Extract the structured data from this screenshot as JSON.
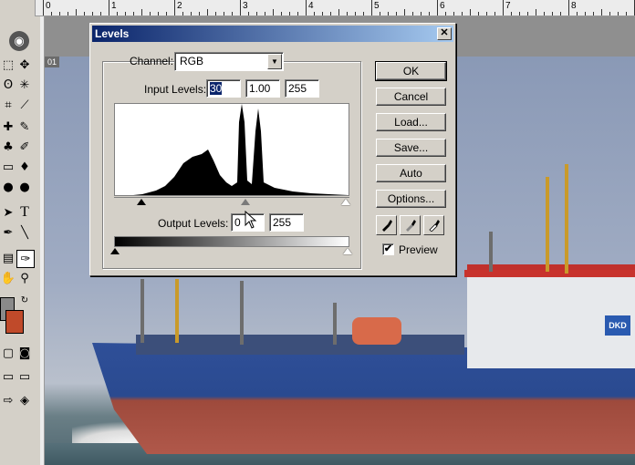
{
  "ruler": {
    "labels": [
      "0",
      "1",
      "2",
      "3",
      "4",
      "5",
      "6",
      "7",
      "8"
    ]
  },
  "document": {
    "label": "01"
  },
  "ship": {
    "sign": "DKD"
  },
  "dialog": {
    "title": "Levels",
    "close_glyph": "✕",
    "channel_label": "Channel:",
    "channel_value": "RGB",
    "input_levels_label": "Input Levels:",
    "input_black": "30",
    "input_gamma": "1.00",
    "input_white": "255",
    "output_levels_label": "Output Levels:",
    "output_black": "0",
    "output_white": "255",
    "buttons": {
      "ok": "OK",
      "cancel": "Cancel",
      "load": "Load...",
      "save": "Save...",
      "auto": "Auto",
      "options": "Options..."
    },
    "preview_label": "Preview",
    "preview_checked": "✔",
    "colors": {
      "title_start": "#0a246a",
      "title_end": "#a6caf0",
      "face": "#d4d0c8"
    }
  }
}
